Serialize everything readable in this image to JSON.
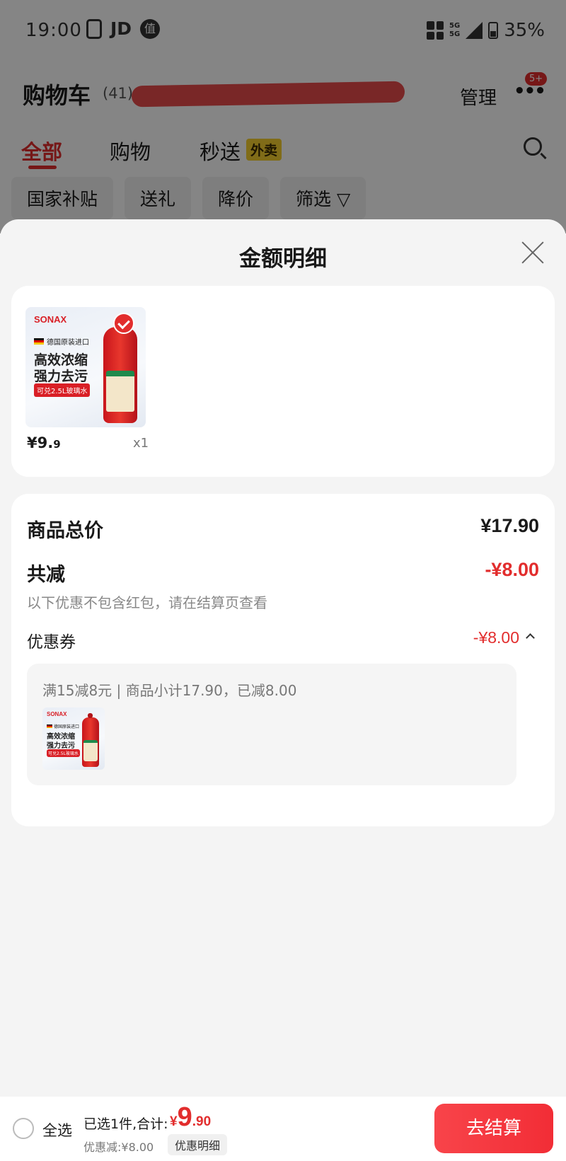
{
  "status_bar": {
    "time": "19:00",
    "jd": "JD",
    "zhi": "值",
    "network": "5G",
    "battery": "35%"
  },
  "header": {
    "title": "购物车",
    "count": "(41)",
    "manage": "管理",
    "more_badge": "5+"
  },
  "tabs": [
    {
      "label": "全部",
      "active": true
    },
    {
      "label": "购物"
    },
    {
      "label": "秒送",
      "badge": "外卖"
    }
  ],
  "filters": [
    "国家补贴",
    "送礼",
    "降价",
    "筛选 ▽"
  ],
  "sheet": {
    "title": "金额明细",
    "product": {
      "brand": "SONAX",
      "origin": "德国原装进口",
      "line1": "高效浓缩",
      "line2": "强力去污",
      "tag": "可兑2.5L玻璃水",
      "price_int": "¥9.",
      "price_dec": "9",
      "qty": "x1"
    },
    "summary": {
      "total_label": "商品总价",
      "total_value": "¥17.90",
      "reduce_label": "共减",
      "reduce_value": "-¥8.00",
      "note": "以下优惠不包含红包，请在结算页查看",
      "coupon_label": "优惠券",
      "coupon_value": "-¥8.00",
      "coupon_desc": "满15减8元 | 商品小计17.90，已减8.00"
    }
  },
  "bottom_bar": {
    "select_all": "全选",
    "selected_text": "已选1件,合计:",
    "price_yen": "¥",
    "price_int": "9",
    "price_dec": ".90",
    "discount_text": "优惠减:¥8.00",
    "detail_label": "优惠明细",
    "checkout_label": "去结算"
  },
  "colors": {
    "accent": "#e22d2d",
    "sheet_bg": "#f4f4f4",
    "card_bg": "#ffffff"
  }
}
